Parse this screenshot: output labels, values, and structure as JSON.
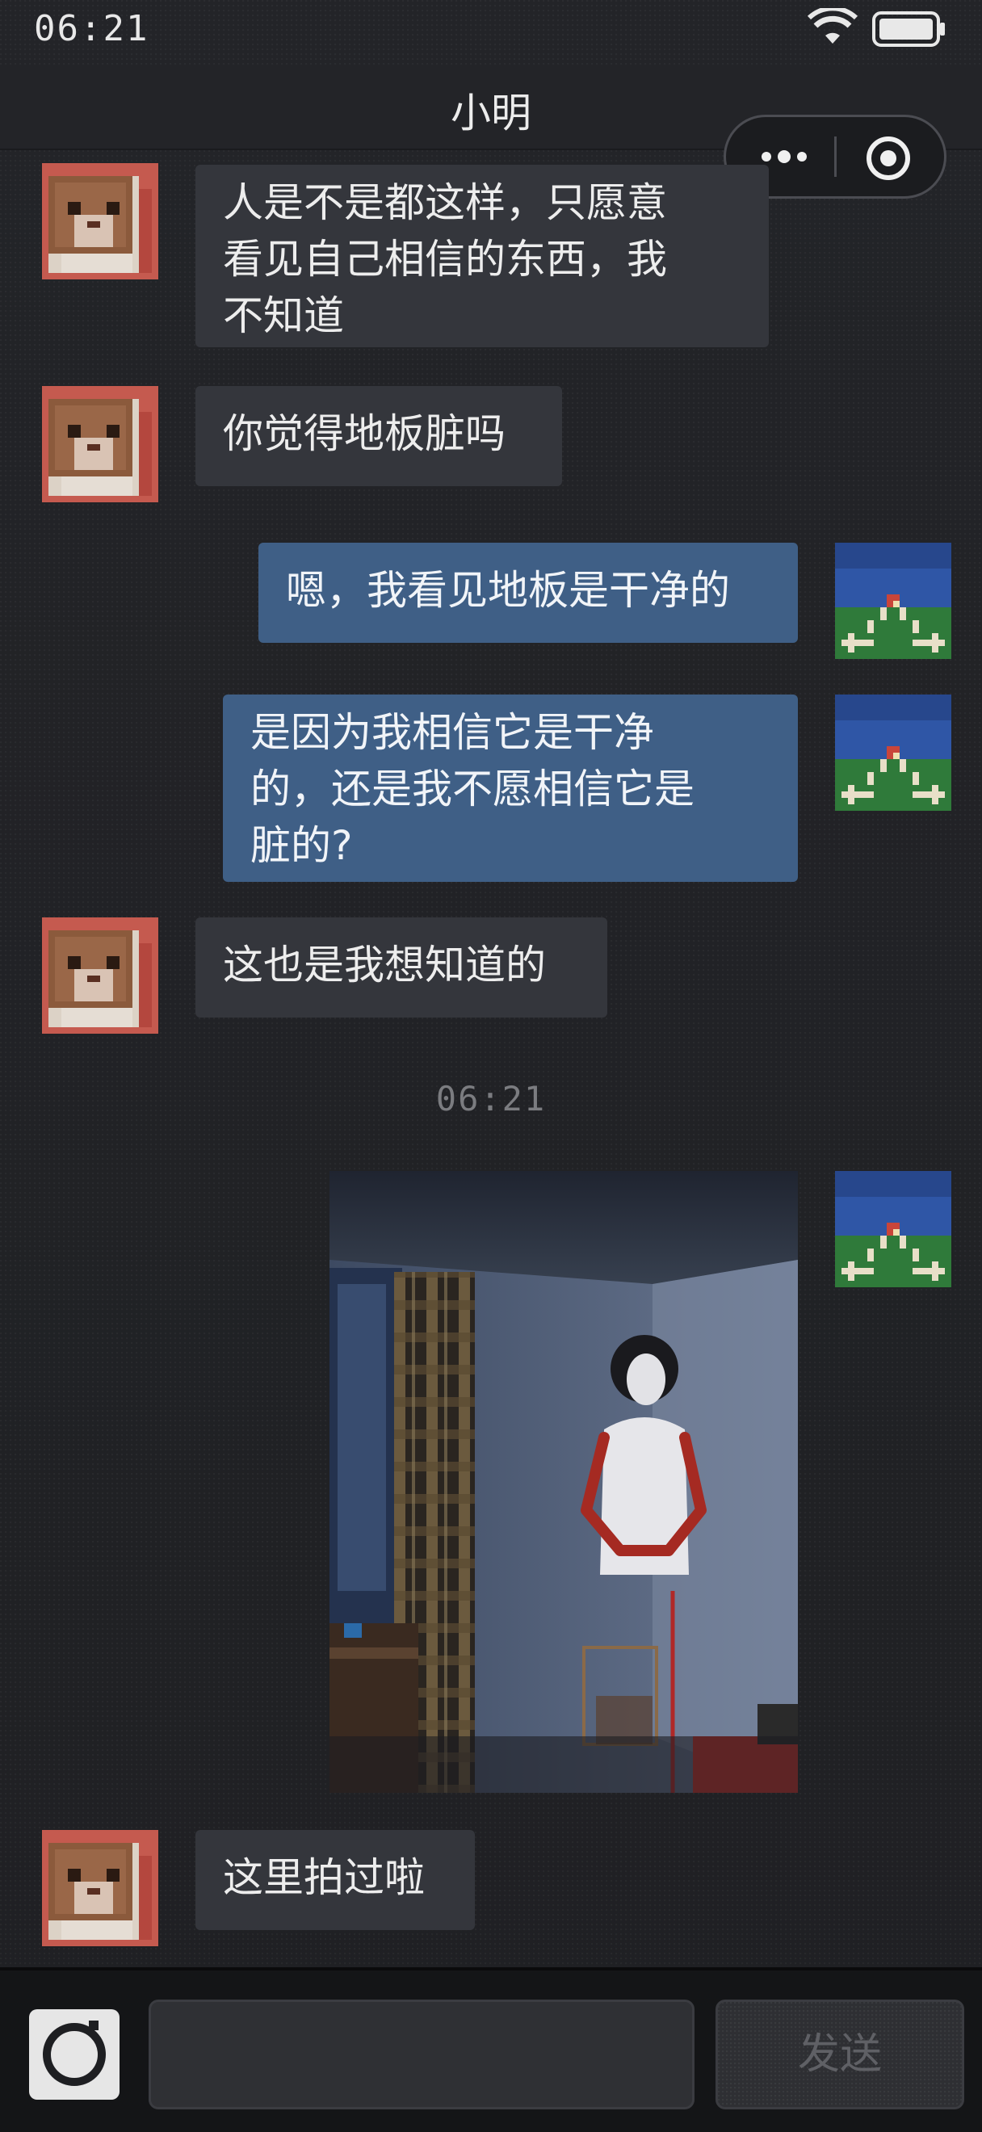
{
  "status_bar": {
    "time": "06:21",
    "wifi_icon": "wifi-icon",
    "battery_icon": "battery-icon"
  },
  "header": {
    "title": "小明",
    "more_icon": "more-dots-icon",
    "close_icon": "target-circle-icon"
  },
  "messages": [
    {
      "side": "left",
      "lines": [
        "人是不是都这样，只愿意",
        "看见自己相信的东西，我",
        "不知道"
      ]
    },
    {
      "side": "left",
      "lines": [
        "你觉得地板脏吗"
      ]
    },
    {
      "side": "right",
      "lines": [
        "嗯，我看见地板是干净的"
      ]
    },
    {
      "side": "right",
      "lines": [
        "是因为我相信它是干净",
        "的，还是我不愿相信它是",
        "脏的?"
      ]
    },
    {
      "side": "left",
      "lines": [
        "这也是我想知道的"
      ]
    },
    {
      "side": "right",
      "type": "image"
    },
    {
      "side": "left",
      "lines": [
        "这里拍过啦"
      ]
    }
  ],
  "timestamp": "06:21",
  "input_bar": {
    "camera_icon": "camera-icon",
    "input_value": "",
    "send_label": "发送"
  },
  "colors": {
    "background": "#202125",
    "left_bubble": "#34363c",
    "right_bubble": "#3f5f86",
    "avatar_contact_bg": "#c75a4f",
    "avatar_self_sky": "#2c55a8"
  }
}
